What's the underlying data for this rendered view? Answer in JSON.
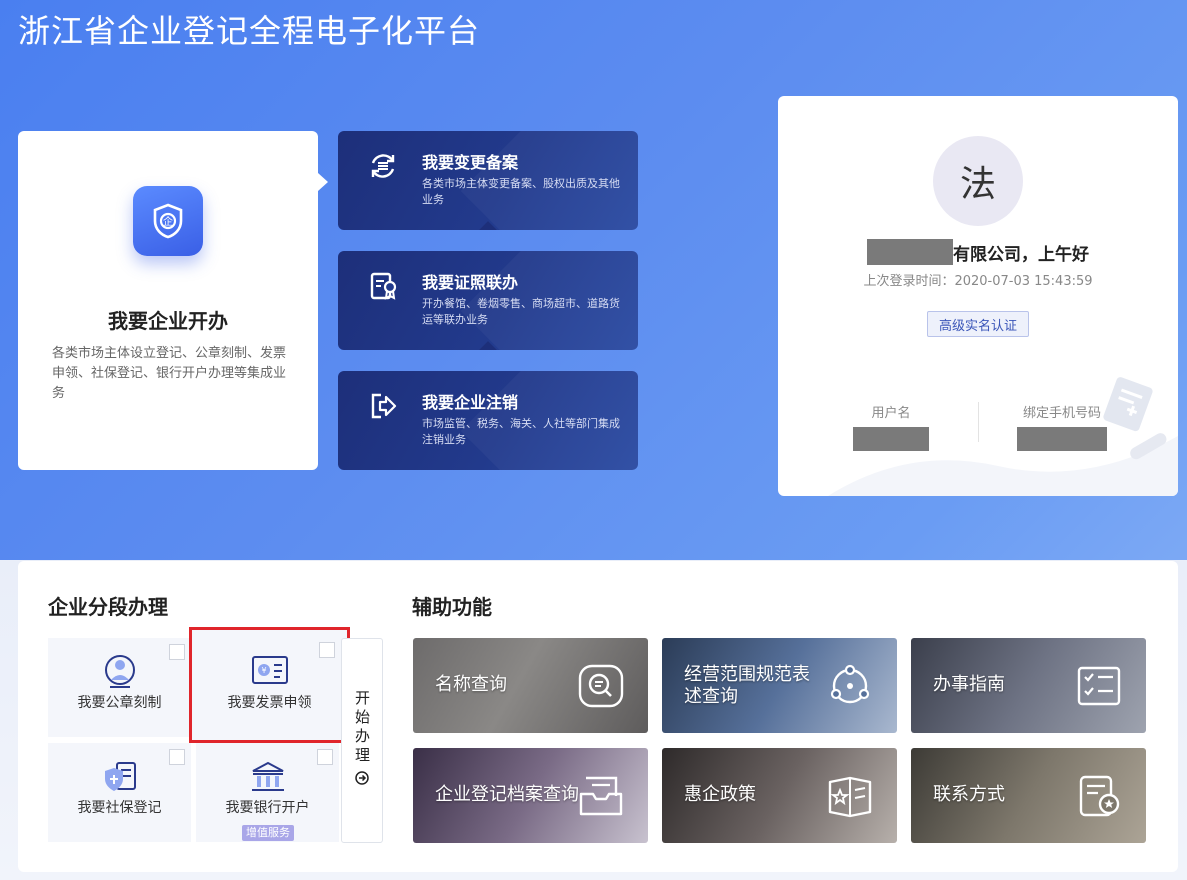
{
  "page": {
    "title": "浙江省企业登记全程电子化平台"
  },
  "start_card": {
    "title": "我要企业开办",
    "desc": "各类市场主体设立登记、公章刻制、发票申领、社保登记、银行开户办理等集成业务"
  },
  "actions": [
    {
      "title": "我要变更备案",
      "desc": "各类市场主体变更备案、股权出质及其他业务",
      "icon": "change-record-icon"
    },
    {
      "title": "我要证照联办",
      "desc": "开办餐馆、卷烟零售、商场超市、道路货运等联办业务",
      "icon": "license-icon"
    },
    {
      "title": "我要企业注销",
      "desc": "市场监管、税务、海关、人社等部门集成注销业务",
      "icon": "logout-icon"
    }
  ],
  "profile": {
    "avatar_char": "法",
    "greeting": "有限公司，上午好",
    "last_login": "上次登录时间：2020-07-03 15:43:59",
    "verify_badge": "高级实名认证",
    "username_label": "用户名",
    "phone_label": "绑定手机号码"
  },
  "stages": {
    "title": "企业分段办理",
    "items": [
      {
        "label": "我要公章刻制",
        "icon": "seal-icon"
      },
      {
        "label": "我要发票申领",
        "icon": "invoice-icon"
      },
      {
        "label": "我要社保登记",
        "icon": "social-security-icon"
      },
      {
        "label": "我要银行开户",
        "icon": "bank-icon",
        "tag": "增值服务"
      }
    ],
    "start_button": "开始办理"
  },
  "aux": {
    "title": "辅助功能",
    "tiles": [
      {
        "label": "名称查询",
        "icon": "name-search-icon"
      },
      {
        "label": "经营范围规范表述查询",
        "icon": "scope-query-icon"
      },
      {
        "label": "办事指南",
        "icon": "guide-icon"
      },
      {
        "label": "企业登记档案查询",
        "icon": "archive-icon"
      },
      {
        "label": "惠企政策",
        "icon": "policy-icon"
      },
      {
        "label": "联系方式",
        "icon": "contact-icon"
      }
    ]
  },
  "colors": {
    "accent": "#3a5fe6",
    "action_card": "#1d2f7a",
    "highlight": "#e0252b",
    "badge_tag": "#a9a6e8"
  }
}
